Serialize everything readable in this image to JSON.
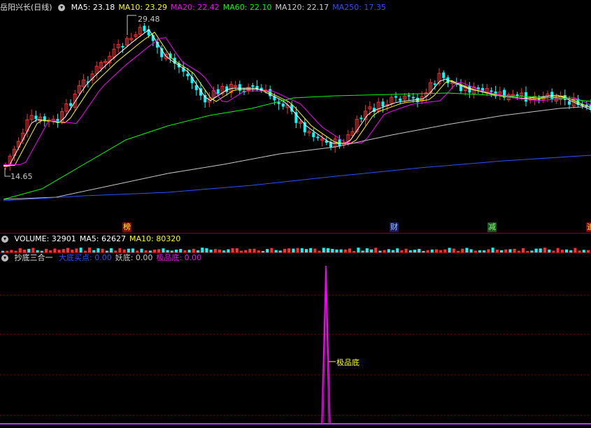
{
  "main_panel": {
    "title": "岳阳兴长(日线)",
    "indicators": [
      {
        "label": "MA5: 23.18",
        "color": "#ffffff"
      },
      {
        "label": "MA10: 23.29",
        "color": "#ffff00"
      },
      {
        "label": "MA20: 22.42",
        "color": "#ff00ff"
      },
      {
        "label": "MA60: 22.10",
        "color": "#00ff00"
      },
      {
        "label": "MA120: 22.17",
        "color": "#d0d0d0"
      },
      {
        "label": "MA250: 17.35",
        "color": "#3050ff"
      }
    ],
    "high_label": "29.48",
    "low_label": "14.65",
    "events": [
      {
        "text": "榜",
        "color": "#ffff00",
        "bg": "#8b0000"
      },
      {
        "text": "财",
        "color": "#8cc8ff",
        "bg": "#1a1a60"
      },
      {
        "text": "减",
        "color": "#80ff80",
        "bg": "#1a501a"
      },
      {
        "text": "追",
        "color": "#ffff00",
        "bg": "#8b0000"
      }
    ]
  },
  "volume_panel": {
    "indicators": [
      {
        "label": "VOLUME: 32901",
        "color": "#ffffff"
      },
      {
        "label": "MA5: 62627",
        "color": "#ffffff"
      },
      {
        "label": "MA10: 80320",
        "color": "#ffff00"
      }
    ]
  },
  "indicator_panel": {
    "name": "抄底三合一",
    "indicators": [
      {
        "label": "大底买点",
        "value": "0.00",
        "color": "#3050ff"
      },
      {
        "label": "妖底",
        "value": "0.00",
        "color": "#c8c8c8"
      },
      {
        "label": "极品底",
        "value": "0.00",
        "color": "#ff00ff"
      }
    ],
    "signal_label": "极品底",
    "signal_color": "#ffff00"
  },
  "colors": {
    "up": "#ff3030",
    "down": "#00ffff",
    "grid": "#8b0000"
  }
}
